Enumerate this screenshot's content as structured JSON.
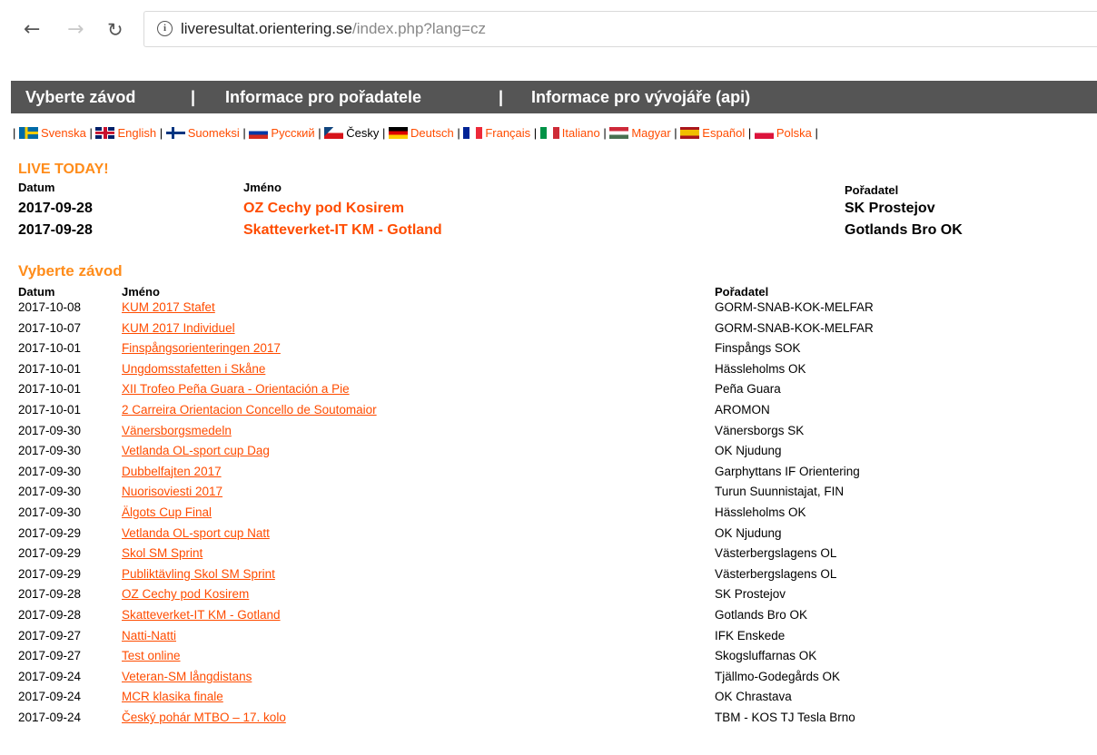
{
  "browser": {
    "url_host": "liveresultat.orientering.se",
    "url_path": "/index.php?lang=cz",
    "info_icon": "i"
  },
  "nav": {
    "items": [
      "Vyberte závod",
      "Informace pro pořadatele",
      "Informace pro vývojáře (api)"
    ],
    "separator": "|"
  },
  "languages": [
    {
      "name": "Svenska",
      "current": false
    },
    {
      "name": "English",
      "current": false
    },
    {
      "name": "Suomeksi",
      "current": false
    },
    {
      "name": "Русский",
      "current": false
    },
    {
      "name": "Česky",
      "current": true
    },
    {
      "name": "Deutsch",
      "current": false
    },
    {
      "name": "Français",
      "current": false
    },
    {
      "name": "Italiano",
      "current": false
    },
    {
      "name": "Magyar",
      "current": false
    },
    {
      "name": "Español",
      "current": false
    },
    {
      "name": "Polska",
      "current": false
    }
  ],
  "live_today": {
    "title": "LIVE TODAY!",
    "headers": {
      "date": "Datum",
      "name": "Jméno",
      "organizer": "Pořadatel"
    },
    "rows": [
      {
        "date": "2017-09-28",
        "name": "OZ Cechy pod Kosirem",
        "organizer": "SK Prostejov"
      },
      {
        "date": "2017-09-28",
        "name": "Skatteverket-IT KM - Gotland",
        "organizer": "Gotlands Bro OK"
      }
    ]
  },
  "races": {
    "title": "Vyberte závod",
    "headers": {
      "date": "Datum",
      "name": "Jméno",
      "organizer": "Pořadatel"
    },
    "rows": [
      {
        "date": "2017-10-08",
        "name": "KUM 2017 Stafet",
        "organizer": "GORM-SNAB-KOK-MELFAR"
      },
      {
        "date": "2017-10-07",
        "name": "KUM 2017 Individuel",
        "organizer": "GORM-SNAB-KOK-MELFAR"
      },
      {
        "date": "2017-10-01",
        "name": "Finspångsorienteringen 2017",
        "organizer": "Finspångs SOK"
      },
      {
        "date": "2017-10-01",
        "name": "Ungdomsstafetten i Skåne",
        "organizer": "Hässleholms OK"
      },
      {
        "date": "2017-10-01",
        "name": "XII Trofeo Peña Guara - Orientación a Pie",
        "organizer": "Peña Guara"
      },
      {
        "date": "2017-10-01",
        "name": "2 Carreira Orientacion Concello de Soutomaior",
        "organizer": "AROMON"
      },
      {
        "date": "2017-09-30",
        "name": "Vänersborgsmedeln",
        "organizer": "Vänersborgs SK"
      },
      {
        "date": "2017-09-30",
        "name": "Vetlanda OL-sport cup Dag",
        "organizer": "OK Njudung"
      },
      {
        "date": "2017-09-30",
        "name": "Dubbelfajten 2017",
        "organizer": "Garphyttans IF Orientering"
      },
      {
        "date": "2017-09-30",
        "name": "Nuorisoviesti 2017",
        "organizer": "Turun Suunnistajat, FIN"
      },
      {
        "date": "2017-09-30",
        "name": "Älgots Cup Final",
        "organizer": "Hässleholms OK"
      },
      {
        "date": "2017-09-29",
        "name": "Vetlanda OL-sport cup Natt",
        "organizer": "OK Njudung"
      },
      {
        "date": "2017-09-29",
        "name": "Skol SM Sprint",
        "organizer": "Västerbergslagens OL"
      },
      {
        "date": "2017-09-29",
        "name": "Publiktävling Skol SM Sprint",
        "organizer": "Västerbergslagens OL"
      },
      {
        "date": "2017-09-28",
        "name": "OZ Cechy pod Kosirem",
        "organizer": "SK Prostejov"
      },
      {
        "date": "2017-09-28",
        "name": "Skatteverket-IT KM - Gotland",
        "organizer": "Gotlands Bro OK"
      },
      {
        "date": "2017-09-27",
        "name": "Natti-Natti",
        "organizer": "IFK Enskede"
      },
      {
        "date": "2017-09-27",
        "name": "Test online",
        "organizer": "Skogsluffarnas OK"
      },
      {
        "date": "2017-09-24",
        "name": "Veteran-SM långdistans",
        "organizer": "Tjällmo-Godegårds OK"
      },
      {
        "date": "2017-09-24",
        "name": "MCR klasika finale",
        "organizer": "OK Chrastava"
      },
      {
        "date": "2017-09-24",
        "name": "Český pohár MTBO – 17. kolo",
        "organizer": "TBM - KOS TJ Tesla Brno"
      }
    ]
  },
  "colors": {
    "accent": "#ff4c00",
    "section_title": "#ff8c1a",
    "nav_bg": "#555555"
  }
}
